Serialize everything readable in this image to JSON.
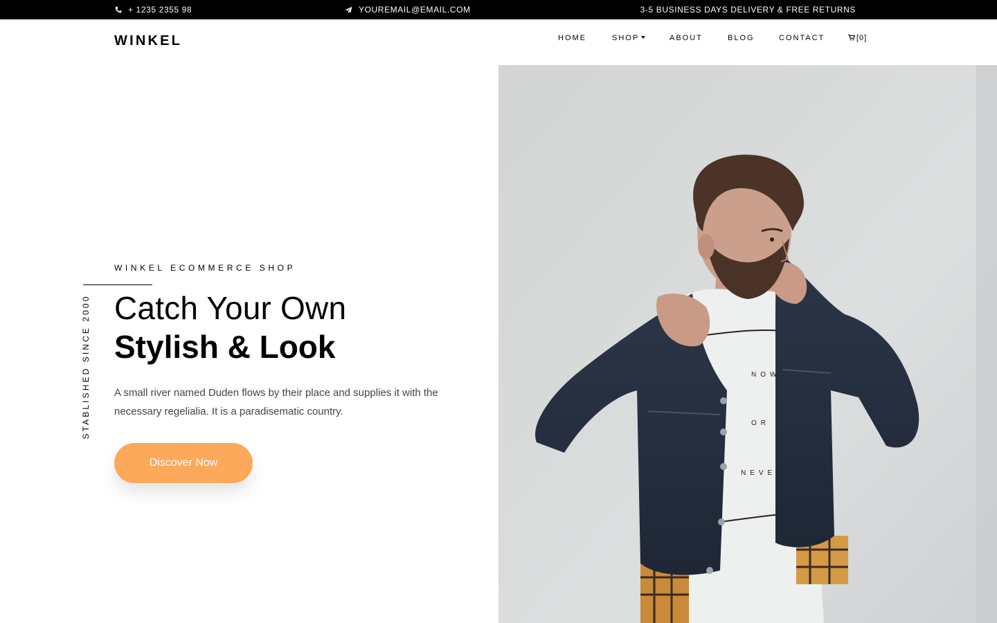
{
  "topbar": {
    "phone": "+ 1235 2355 98",
    "email": "YOUREMAIL@EMAIL.COM",
    "delivery": "3-5 BUSINESS DAYS DELIVERY & FREE RETURNS"
  },
  "nav": {
    "brand": "WINKEL",
    "items": [
      "HOME",
      "SHOP",
      "ABOUT",
      "BLOG",
      "CONTACT"
    ],
    "cart_label": "[0]"
  },
  "hero": {
    "eyebrow": "WINKEL ECOMMERCE SHOP",
    "vertical_text": "STABLISHED SINCE 2000",
    "title_line1": "Catch Your Own",
    "title_line2": "Stylish & Look",
    "description": "A small river named Duden flows by their place and supplies it with the necessary regelialia. It is a paradisematic country.",
    "cta_label": "Discover Now",
    "shirt_text": [
      "NOW",
      "OR",
      "NEVER"
    ]
  },
  "colors": {
    "accent": "#fca95c",
    "topbar_bg": "#000000",
    "text": "#000000",
    "body_text": "#444444"
  },
  "icons": {
    "phone": "phone-icon",
    "email": "paper-plane-icon",
    "cart": "cart-icon",
    "shop_caret": "caret-down-icon"
  }
}
